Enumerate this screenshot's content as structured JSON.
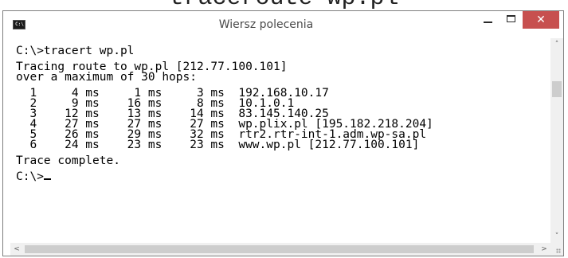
{
  "caption": "traceroute wp.pl",
  "window": {
    "title": "Wiersz polecenia",
    "icon_label": "C:\\"
  },
  "titlebar_buttons": {
    "minimize_icon": "minimize-icon",
    "maximize_icon": "maximize-icon",
    "close_glyph": "✕"
  },
  "console": {
    "lines": [
      "C:\\>tracert wp.pl",
      "",
      "Tracing route to wp.pl [212.77.100.101]",
      "over a maximum of 30 hops:",
      "",
      "  1     4 ms     1 ms     3 ms  192.168.10.17",
      "  2     9 ms    16 ms     8 ms  10.1.0.1",
      "  3    12 ms    13 ms    14 ms  83.145.140.25",
      "  4    27 ms    27 ms    27 ms  wp.plix.pl [195.182.218.204]",
      "  5    26 ms    29 ms    32 ms  rtr2.rtr-int-1.adm.wp-sa.pl",
      "  6    24 ms    23 ms    23 ms  www.wp.pl [212.77.100.101]",
      "",
      "Trace complete.",
      "",
      "C:\\>"
    ]
  },
  "scrollbars": {
    "up_glyph": "˄",
    "down_glyph": "˅",
    "left_glyph": "<",
    "right_glyph": ">"
  }
}
